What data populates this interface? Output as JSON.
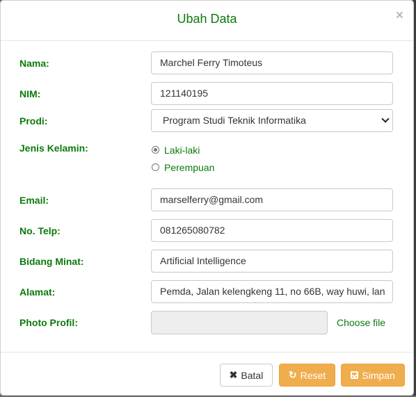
{
  "modal": {
    "title": "Ubah Data",
    "close_symbol": "×"
  },
  "form": {
    "nama": {
      "label": "Nama:",
      "value": "Marchel Ferry Timoteus"
    },
    "nim": {
      "label": "NIM:",
      "value": "121140195"
    },
    "prodi": {
      "label": "Prodi:",
      "selected": "Program Studi Teknik Informatika"
    },
    "jenis_kelamin": {
      "label": "Jenis Kelamin:",
      "options": [
        {
          "label": "Laki-laki",
          "checked": true
        },
        {
          "label": "Perempuan",
          "checked": false
        }
      ]
    },
    "email": {
      "label": "Email:",
      "value": "marselferry@gmail.com"
    },
    "telp": {
      "label": "No. Telp:",
      "value": "081265080782"
    },
    "bidang_minat": {
      "label": "Bidang Minat:",
      "value": "Artificial Intelligence"
    },
    "alamat": {
      "label": "Alamat:",
      "value": "Pemda, Jalan kelengkeng 11, no 66B, way huwi, lan"
    },
    "photo": {
      "label": "Photo Profil:",
      "choose_label": "Choose file"
    }
  },
  "footer": {
    "batal_label": "Batal",
    "batal_icon": "x-icon",
    "reset_label": "Reset",
    "reset_icon": "refresh-icon",
    "simpan_label": "Simpan",
    "simpan_icon": "check-square-icon"
  },
  "colors": {
    "label_green": "#0b7a0b",
    "warning": "#f0ad4e"
  }
}
